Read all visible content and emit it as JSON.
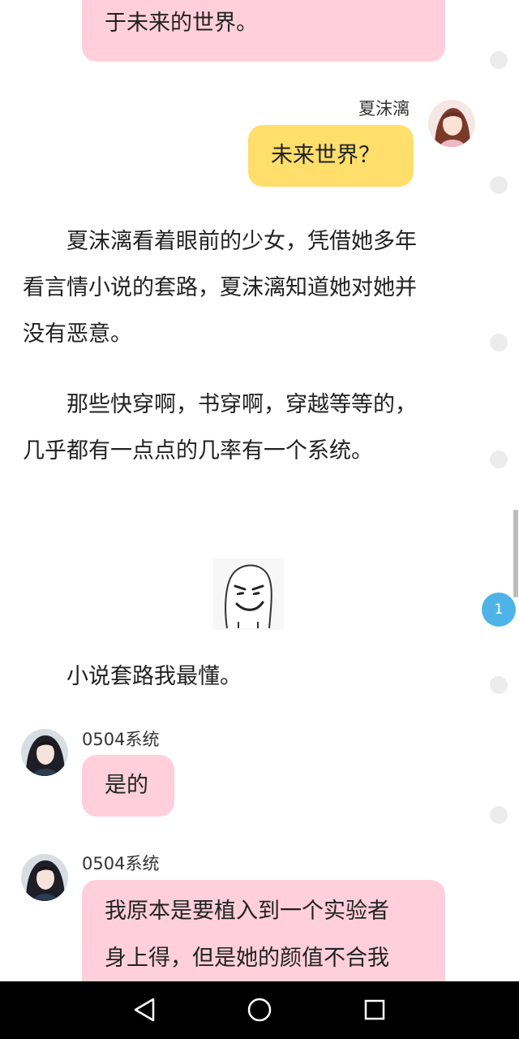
{
  "chat": {
    "top_bubble": {
      "text": "于未来的世界。"
    },
    "msg_xiamoli": {
      "sender": "夏沫漓",
      "text": "未来世界？"
    },
    "paragraphs": [
      {
        "lines": [
          "　　夏沫漓看着眼前的少女，凭借她多年",
          "看言情小说的套路，夏沫漓知道她对她并",
          "没有恶意。"
        ]
      },
      {
        "lines": [
          "　　那些快穿啊，书穿啊，穿越等等的，",
          "几乎都有一点点的几率有一个系统。"
        ]
      }
    ],
    "sticker": {
      "icon": "smirk-face-sticker"
    },
    "caption": "　　小说套路我最懂。",
    "msg_system_1": {
      "sender": "0504系统",
      "text": "是的"
    },
    "msg_system_2": {
      "sender": "0504系统",
      "lines": [
        "我原本是要植入到一个实验者",
        "身上得，但是她的颜值不合我"
      ]
    }
  },
  "side": {
    "comment_count": "1"
  },
  "nav": {
    "back_icon": "back-triangle-icon",
    "home_icon": "home-circle-icon",
    "recents_icon": "recents-square-icon"
  },
  "colors": {
    "pink_bubble": "#ffd0dc",
    "yellow_bubble": "#ffde6b",
    "badge_blue": "#4fb3e8",
    "nav_bar": "#000000"
  }
}
